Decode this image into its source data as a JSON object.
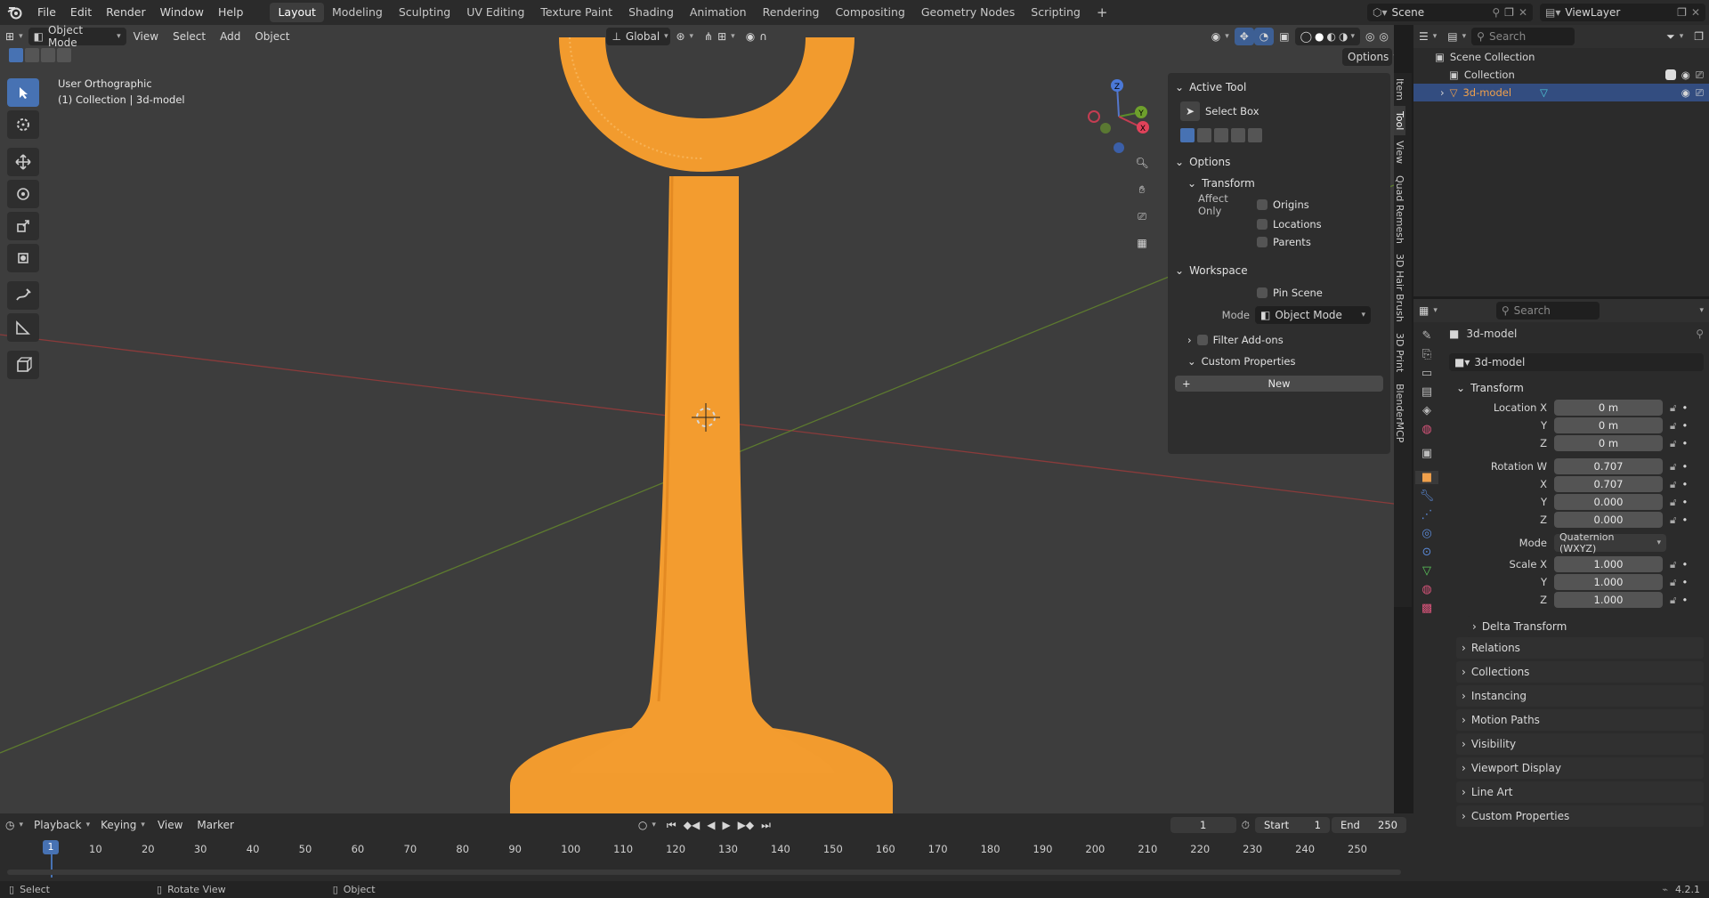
{
  "app": {
    "version": "4.2.1"
  },
  "menu": [
    "File",
    "Edit",
    "Render",
    "Window",
    "Help"
  ],
  "workspaces": [
    "Layout",
    "Modeling",
    "Sculpting",
    "UV Editing",
    "Texture Paint",
    "Shading",
    "Animation",
    "Rendering",
    "Compositing",
    "Geometry Nodes",
    "Scripting"
  ],
  "active_workspace": "Layout",
  "scene": {
    "label": "Scene"
  },
  "viewlayer": {
    "label": "ViewLayer"
  },
  "viewport": {
    "mode": "Object Mode",
    "menus": [
      "View",
      "Select",
      "Add",
      "Object"
    ],
    "orientation": "Global",
    "options": "Options",
    "overlay_title": "User Orthographic",
    "overlay_subtitle": "(1) Collection | 3d-model",
    "gizmo": {
      "x": "X",
      "y": "Y",
      "z": "Z"
    }
  },
  "npanel": {
    "active_tool": "Active Tool",
    "tool_name": "Select Box",
    "options": "Options",
    "transform": "Transform",
    "affect_only": "Affect Only",
    "checks": [
      "Origins",
      "Locations",
      "Parents"
    ],
    "workspace": "Workspace",
    "pin_scene": "Pin Scene",
    "mode_label": "Mode",
    "mode_value": "Object Mode",
    "filter_addons": "Filter Add-ons",
    "custom_props": "Custom Properties",
    "new_btn": "New",
    "tabs": [
      "Item",
      "Tool",
      "View",
      "Quad Remesh",
      "3D Hair Brush",
      "3D Print",
      "BlenderMCP"
    ]
  },
  "outliner": {
    "search": "Search",
    "scene_collection": "Scene Collection",
    "collection": "Collection",
    "object": "3d-model"
  },
  "properties": {
    "search": "Search",
    "object_name": "3d-model",
    "data_name": "3d-model",
    "transform": "Transform",
    "location": {
      "label_x": "Location X",
      "label_y": "Y",
      "label_z": "Z",
      "x": "0 m",
      "y": "0 m",
      "z": "0 m"
    },
    "rotation": {
      "label_w": "Rotation W",
      "label_x": "X",
      "label_y": "Y",
      "label_z": "Z",
      "w": "0.707",
      "x": "0.707",
      "y": "0.000",
      "z": "0.000"
    },
    "mode_label": "Mode",
    "mode_value": "Quaternion (WXYZ)",
    "scale": {
      "label_x": "Scale X",
      "label_y": "Y",
      "label_z": "Z",
      "x": "1.000",
      "y": "1.000",
      "z": "1.000"
    },
    "delta": "Delta Transform",
    "sections": [
      "Relations",
      "Collections",
      "Instancing",
      "Motion Paths",
      "Visibility",
      "Viewport Display",
      "Line Art",
      "Custom Properties"
    ]
  },
  "timeline": {
    "menus": [
      "Playback",
      "Keying",
      "View",
      "Marker"
    ],
    "current_frame": "1",
    "start_label": "Start",
    "start": "1",
    "end_label": "End",
    "end": "250",
    "ticks": [
      "1",
      "10",
      "20",
      "30",
      "40",
      "50",
      "60",
      "70",
      "80",
      "90",
      "100",
      "110",
      "120",
      "130",
      "140",
      "150",
      "160",
      "170",
      "180",
      "190",
      "200",
      "210",
      "220",
      "230",
      "240",
      "250"
    ]
  },
  "status": {
    "select": "Select",
    "rotate": "Rotate View",
    "object": "Object"
  }
}
